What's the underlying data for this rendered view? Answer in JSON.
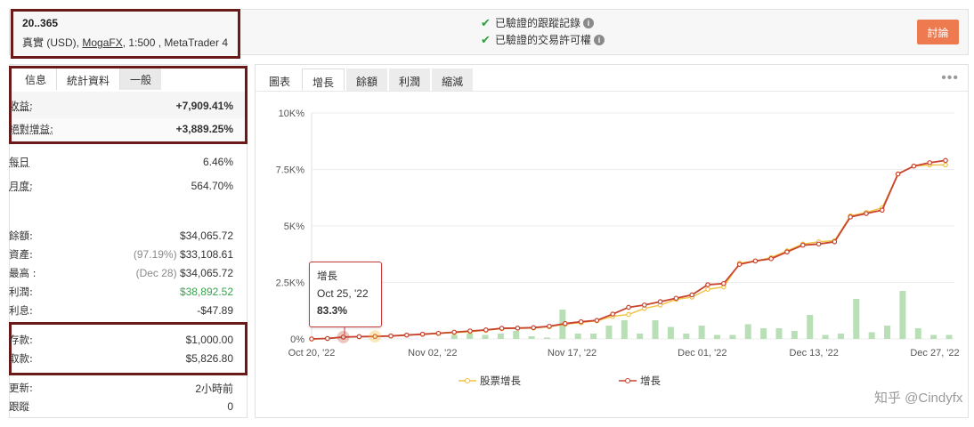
{
  "account": {
    "id": "20..365",
    "type": "真實 (USD),",
    "broker": "MogaFX",
    "details": ", 1:500 , MetaTrader 4"
  },
  "verification": {
    "items": [
      "已驗證的跟蹤記錄",
      "已驗證的交易許可權"
    ],
    "info_icon": "i"
  },
  "discuss_button": "討論",
  "left_tabs": [
    "信息",
    "統計資料",
    "一般"
  ],
  "stats": {
    "gain_label": "收益:",
    "gain_value": "+7,909.41%",
    "abs_gain_label": "絕對增益:",
    "abs_gain_value": "+3,889.25%",
    "daily_label": "每日",
    "daily_value": "6.46%",
    "monthly_label": "月度:",
    "monthly_value": "564.70%",
    "balance_label": "餘額:",
    "balance_value": "$34,065.72",
    "equity_label": "資產:",
    "equity_pct": "(97.19%)",
    "equity_value": "$33,108.61",
    "highest_label": "最高 :",
    "highest_date": "(Dec 28)",
    "highest_value": "$34,065.72",
    "profit_label": "利潤:",
    "profit_value": "$38,892.52",
    "interest_label": "利息:",
    "interest_value": "-$47.89",
    "deposits_label": "存款:",
    "deposits_value": "$1,000.00",
    "withdrawals_label": "取款:",
    "withdrawals_value": "$5,826.80",
    "updated_label": "更新:",
    "updated_value": "2小時前",
    "tracking_label": "跟蹤",
    "tracking_value": "0"
  },
  "chart_tabs": [
    "圖表",
    "增長",
    "餘額",
    "利潤",
    "縮減"
  ],
  "more_icon": "•••",
  "tooltip": {
    "title": "增長",
    "date": "Oct 25, '22",
    "value": "83.3%"
  },
  "watermark": "知乎 @Cindyfx",
  "colors": {
    "growth": "#c8422e",
    "equity": "#f0c040",
    "bars": "#b9dfb6",
    "accent": "#ee7b4f",
    "highlight_border": "#6b1a1a"
  },
  "chart_data": {
    "type": "line",
    "y_ticks": [
      "0%",
      "2.5K%",
      "5K%",
      "7.5K%",
      "10K%"
    ],
    "ylim": [
      0,
      10000
    ],
    "x_ticks": [
      "Oct 20, '22",
      "Nov 02, '22",
      "Nov 17, '22",
      "Dec 01, '22",
      "Dec 13, '22",
      "Dec 27, '22"
    ],
    "series": [
      {
        "name": "股票增長",
        "values": [
          0,
          20,
          83,
          100,
          110,
          130,
          170,
          200,
          240,
          280,
          320,
          380,
          450,
          470,
          480,
          540,
          650,
          720,
          800,
          1000,
          1080,
          1350,
          1500,
          1750,
          1850,
          2200,
          2300,
          3350,
          3450,
          3600,
          3900,
          4200,
          4300,
          4350,
          5450,
          5600,
          5800,
          7300,
          7650,
          7700,
          7700
        ]
      },
      {
        "name": "增長",
        "values": [
          0,
          20,
          83,
          100,
          110,
          130,
          170,
          210,
          250,
          300,
          350,
          400,
          470,
          480,
          500,
          560,
          680,
          760,
          820,
          1100,
          1400,
          1500,
          1650,
          1800,
          1950,
          2400,
          2450,
          3300,
          3450,
          3550,
          3850,
          4150,
          4200,
          4300,
          5400,
          5550,
          5700,
          7300,
          7650,
          7800,
          7900
        ]
      }
    ],
    "volume_bars": [
      0,
      0,
      0,
      0,
      0,
      0,
      0,
      0,
      0,
      0.15,
      0.2,
      0.15,
      0.2,
      0.3,
      0.1,
      0.05,
      1.1,
      0.2,
      0.2,
      0.5,
      0.7,
      0.2,
      0.7,
      0.45,
      0.2,
      0.5,
      0.15,
      0.15,
      0.55,
      0.4,
      0.4,
      0.3,
      0.9,
      0.15,
      0.2,
      1.5,
      0.25,
      0.5,
      1.8,
      0.4,
      0.15,
      0.15
    ]
  }
}
